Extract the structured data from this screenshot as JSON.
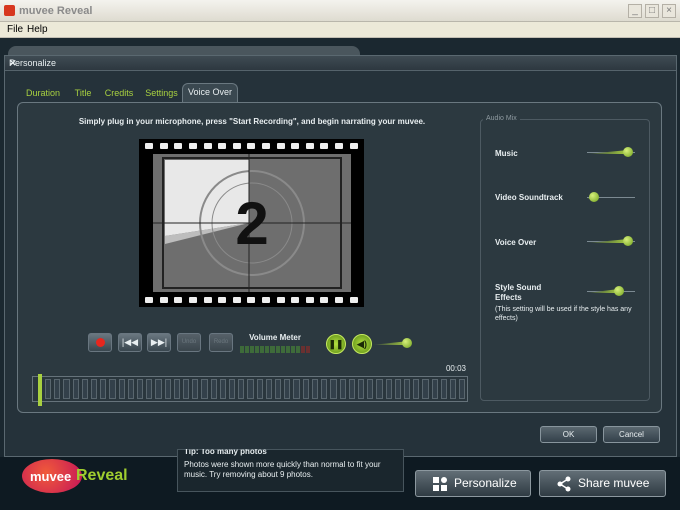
{
  "app": {
    "title": "muvee Reveal",
    "menu": [
      "File",
      "Help"
    ]
  },
  "dialog": {
    "title": "Personalize",
    "tabs": [
      "Duration",
      "Title",
      "Credits",
      "Settings",
      "Voice Over"
    ],
    "active_tab": "Voice Over",
    "instruction": "Simply plug in your microphone, press \"Start Recording\", and begin narrating your muvee.",
    "preview_number": "2",
    "controls": {
      "undo": "Undo",
      "redo": "Redo",
      "volume_meter": "Volume Meter"
    },
    "time": "00:03",
    "audio_mix": {
      "label": "Audio Mix",
      "items": [
        {
          "name": "Music",
          "level": 0.95
        },
        {
          "name": "Video Soundtrack",
          "level": 0.05
        },
        {
          "name": "Voice Over",
          "level": 0.95
        },
        {
          "name": "Style Sound Effects",
          "level": 0.7
        }
      ],
      "note": "(This setting will be used if the style has any effects)"
    },
    "buttons": {
      "ok": "OK",
      "cancel": "Cancel"
    }
  },
  "footer": {
    "logo_left": "muvee",
    "logo_right": "Reveal",
    "tip_title": "Tip: Too many photos",
    "tip_body": "Photos were shown more quickly than normal to fit your music. Try removing about 9 photos.",
    "personalize": "Personalize",
    "share": "Share muvee"
  },
  "colors": {
    "accent": "#a8d040",
    "record": "#e8261e"
  }
}
